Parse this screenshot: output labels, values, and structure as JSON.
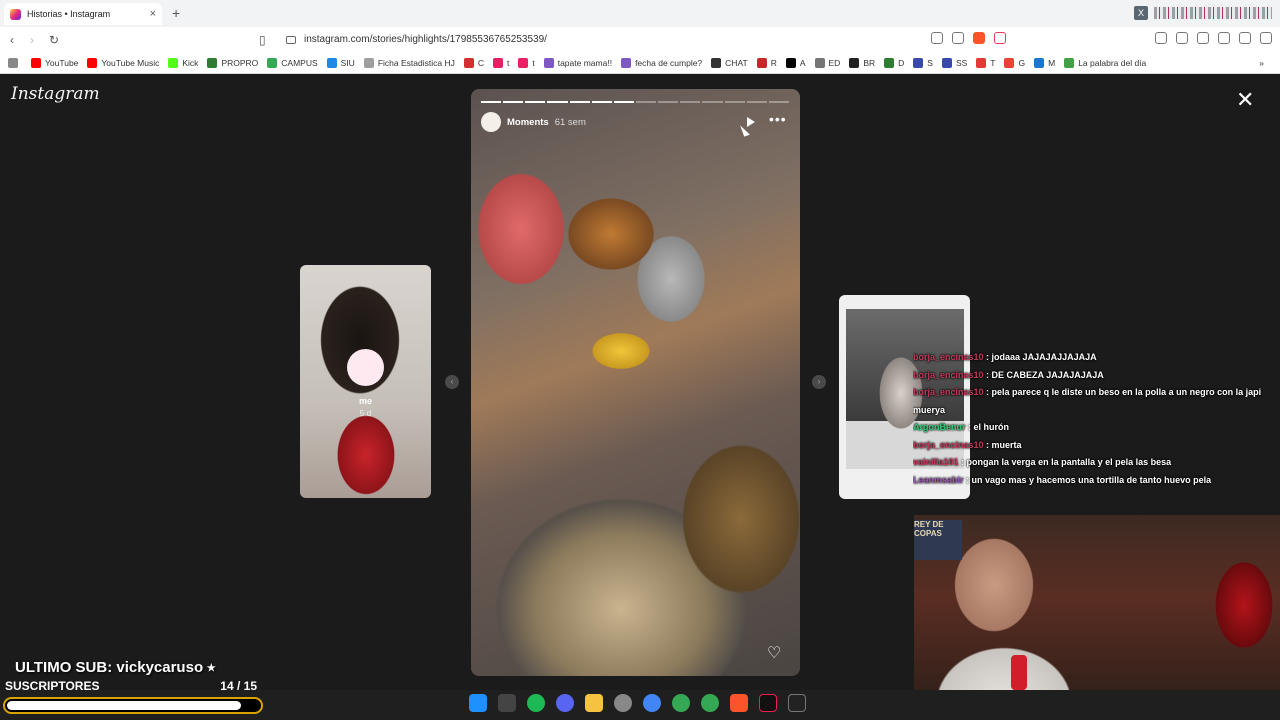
{
  "browser": {
    "tab_title": "Historias • Instagram",
    "tab_close": "×",
    "new_tab": "+",
    "url": "instagram.com/stories/highlights/17985536765253539/"
  },
  "bookmarks": [
    {
      "label": "YouTube",
      "color": "#ff0000"
    },
    {
      "label": "YouTube Music",
      "color": "#ff0000"
    },
    {
      "label": "Kick",
      "color": "#53fc18"
    },
    {
      "label": "PROPRO",
      "color": "#2e7d32"
    },
    {
      "label": "CAMPUS",
      "color": "#34a853"
    },
    {
      "label": "SIU",
      "color": "#1e88e5"
    },
    {
      "label": "Ficha Estadistica HJ",
      "color": "#9e9e9e"
    },
    {
      "label": "C",
      "color": "#d32f2f"
    },
    {
      "label": "t",
      "color": "#e91e63"
    },
    {
      "label": "t",
      "color": "#e91e63"
    },
    {
      "label": "tapate mama!!",
      "color": "#7e57c2"
    },
    {
      "label": "fecha de cumple?",
      "color": "#7e57c2"
    },
    {
      "label": "CHAT",
      "color": "#333333"
    },
    {
      "label": "R",
      "color": "#c62828"
    },
    {
      "label": "A",
      "color": "#000000"
    },
    {
      "label": "ED",
      "color": "#757575"
    },
    {
      "label": "BR",
      "color": "#212121"
    },
    {
      "label": "D",
      "color": "#2e7d32"
    },
    {
      "label": "S",
      "color": "#3949ab"
    },
    {
      "label": "SS",
      "color": "#3949ab"
    },
    {
      "label": "T",
      "color": "#e53935"
    },
    {
      "label": "G",
      "color": "#ea4335"
    },
    {
      "label": "M",
      "color": "#1976d2"
    },
    {
      "label": "La palabra del día",
      "color": "#43a047"
    }
  ],
  "instagram": {
    "logo": "Instagram",
    "close": "✕",
    "story": {
      "username": "Moments",
      "time": "61 sem",
      "more": "•••",
      "heart": "♡",
      "segments_total": 14,
      "segments_done": 7
    },
    "left_story": {
      "name": "me",
      "time": "5 d"
    },
    "nav_prev": "‹",
    "nav_next": "›"
  },
  "chat": [
    {
      "user": "borja_encinas10",
      "user_color": "#c0395b",
      "message": "jodaaa JAJAJAJJAJAJA"
    },
    {
      "user": "borja_encinas10",
      "user_color": "#c0395b",
      "message": "DE CABEZA JAJAJAJAJA"
    },
    {
      "user": "borja_encinas10",
      "user_color": "#c0395b",
      "message": "pela parece q le diste un beso en la polla a un negro con la japi"
    },
    {
      "user": "",
      "user_color": "#ffffff",
      "message": "muerya"
    },
    {
      "user": "ArgonBenur",
      "user_color": "#2ecc71",
      "message": "el hurón"
    },
    {
      "user": "borja_encinas10",
      "user_color": "#c0395b",
      "message": "muerta"
    },
    {
      "user": "vainilla101",
      "user_color": "#c0395b",
      "message": "pongan la verga en la pantalla y el pela las besa"
    },
    {
      "user": "Leanmsabir",
      "user_color": "#9b59b6",
      "message": "un vago mas y hacemos una tortilla de tanto huevo pela"
    }
  ],
  "overlay": {
    "last_sub": "ULTIMO SUB: vickycaruso ⭑",
    "subs_label": "SUSCRIPTORES",
    "subs_count": "14  / 15",
    "subs_progress": 0.93
  },
  "webcam": {
    "banner_text": "REY DE COPAS"
  }
}
